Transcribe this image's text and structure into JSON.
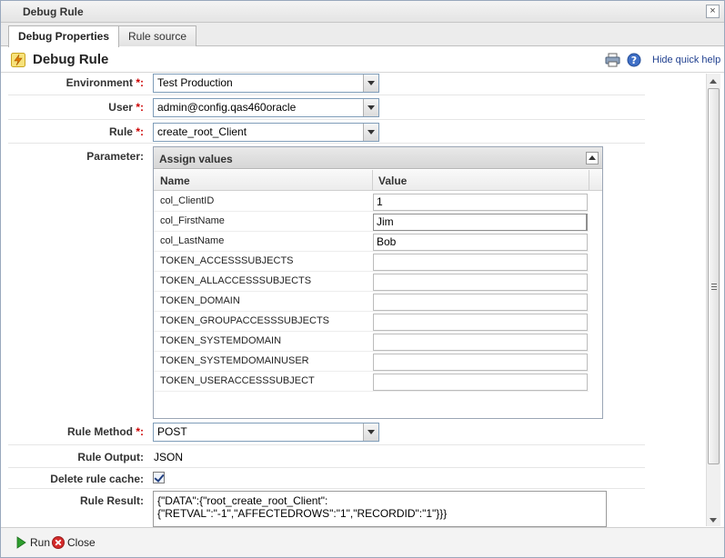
{
  "window": {
    "title": "Debug Rule"
  },
  "tabs": [
    {
      "label": "Debug Properties",
      "active": true
    },
    {
      "label": "Rule source",
      "active": false
    }
  ],
  "header": {
    "title": "Debug Rule",
    "hide_help": "Hide quick help"
  },
  "form": {
    "environment": {
      "label": "Environment",
      "value": "Test Production"
    },
    "user": {
      "label": "User",
      "value": "admin@config.qas460oracle"
    },
    "rule": {
      "label": "Rule",
      "value": "create_root_Client"
    },
    "parameter": {
      "label": "Parameter:"
    },
    "rule_method": {
      "label": "Rule Method",
      "value": "POST"
    },
    "rule_output": {
      "label": "Rule Output:",
      "value": "JSON"
    },
    "delete_cache": {
      "label": "Delete rule cache:",
      "checked": true
    },
    "rule_result": {
      "label": "Rule Result:",
      "value": "{\"DATA\":{\"root_create_root_Client\":\n{\"RETVAL\":\"-1\",\"AFFECTEDROWS\":\"1\",\"RECORDID\":\"1\"}}}"
    }
  },
  "grid": {
    "title": "Assign values",
    "col_name": "Name",
    "col_value": "Value",
    "rows": [
      {
        "name": "col_ClientID",
        "value": "1"
      },
      {
        "name": "col_FirstName",
        "value": "Jim"
      },
      {
        "name": "col_LastName",
        "value": "Bob"
      },
      {
        "name": "TOKEN_ACCESSSUBJECTS",
        "value": ""
      },
      {
        "name": "TOKEN_ALLACCESSSUBJECTS",
        "value": ""
      },
      {
        "name": "TOKEN_DOMAIN",
        "value": ""
      },
      {
        "name": "TOKEN_GROUPACCESSSUBJECTS",
        "value": ""
      },
      {
        "name": "TOKEN_SYSTEMDOMAIN",
        "value": ""
      },
      {
        "name": "TOKEN_SYSTEMDOMAINUSER",
        "value": ""
      },
      {
        "name": "TOKEN_USERACCESSSUBJECT",
        "value": ""
      }
    ]
  },
  "required_marker": "*:",
  "footer": {
    "run_label": "Run",
    "close_label": "Close"
  },
  "icons": {
    "window_close": "close-icon",
    "header": "lightning-icon",
    "print": "print-icon",
    "help": "help-icon",
    "run": "play-icon",
    "close": "close-circle-icon"
  },
  "colors": {
    "accent": "#1f3f8f",
    "required": "#cc0000",
    "run_green": "#2e9e2e",
    "close_red": "#d42a2a"
  }
}
